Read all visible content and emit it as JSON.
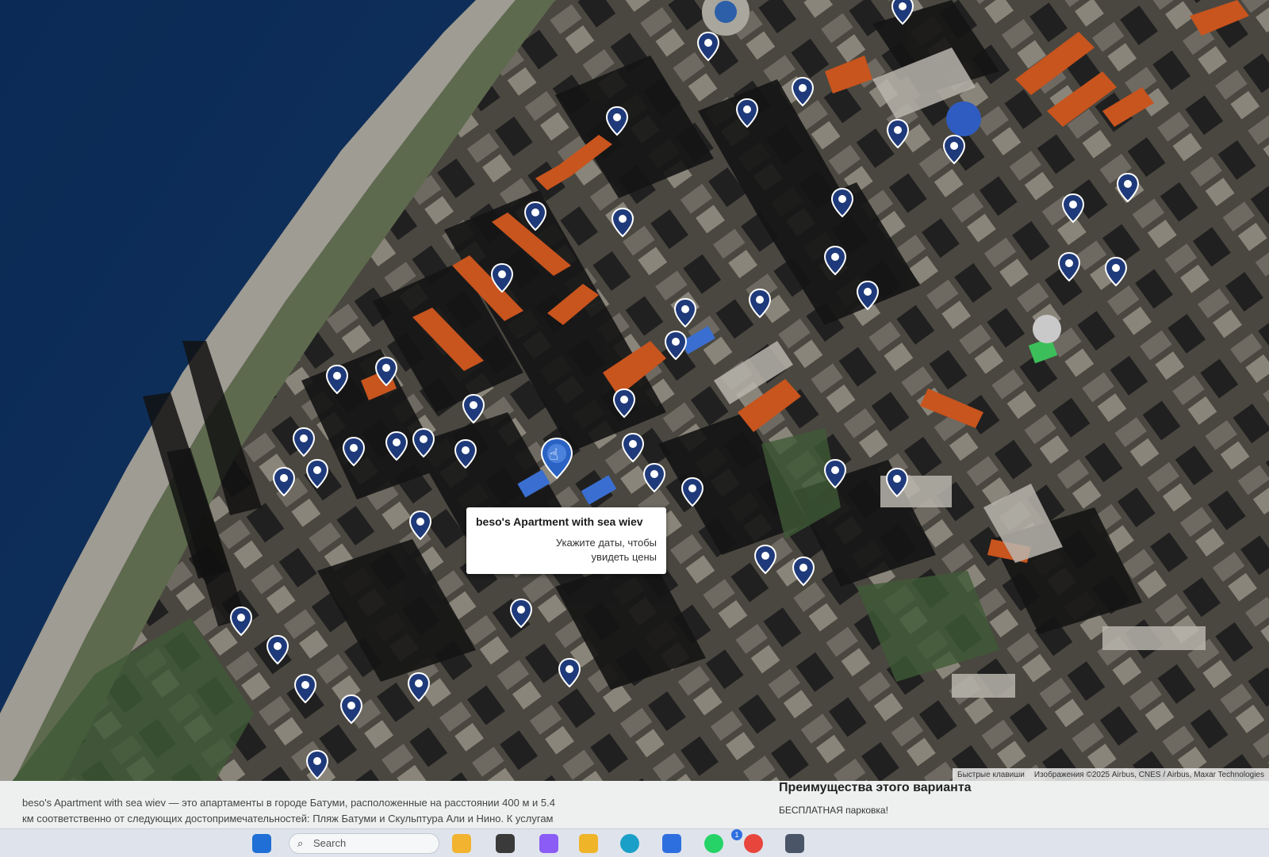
{
  "map": {
    "imagery": "satellite",
    "marker_color": "#1f3a7a",
    "active_marker_color": "#2a63c4",
    "markers_count": 52,
    "markers": [
      {
        "id": "listing-pin"
      },
      {
        "id": "listing-pin"
      },
      {
        "id": "listing-pin"
      },
      {
        "id": "listing-pin"
      },
      {
        "id": "listing-pin"
      },
      {
        "id": "listing-pin"
      },
      {
        "id": "listing-pin"
      },
      {
        "id": "listing-pin"
      },
      {
        "id": "listing-pin"
      },
      {
        "id": "listing-pin"
      },
      {
        "id": "listing-pin"
      },
      {
        "id": "listing-pin"
      },
      {
        "id": "listing-pin"
      },
      {
        "id": "listing-pin"
      },
      {
        "id": "listing-pin"
      },
      {
        "id": "listing-pin"
      },
      {
        "id": "listing-pin"
      },
      {
        "id": "listing-pin"
      },
      {
        "id": "listing-pin"
      },
      {
        "id": "listing-pin"
      },
      {
        "id": "listing-pin"
      },
      {
        "id": "listing-pin"
      },
      {
        "id": "listing-pin"
      },
      {
        "id": "listing-pin"
      },
      {
        "id": "listing-pin"
      },
      {
        "id": "listing-pin"
      },
      {
        "id": "listing-pin"
      },
      {
        "id": "listing-pin"
      },
      {
        "id": "listing-pin"
      },
      {
        "id": "listing-pin"
      },
      {
        "id": "listing-pin"
      },
      {
        "id": "listing-pin"
      },
      {
        "id": "listing-pin"
      },
      {
        "id": "listing-pin"
      },
      {
        "id": "listing-pin"
      },
      {
        "id": "listing-pin"
      },
      {
        "id": "listing-pin"
      },
      {
        "id": "listing-pin"
      },
      {
        "id": "listing-pin"
      },
      {
        "id": "listing-pin"
      },
      {
        "id": "listing-pin"
      },
      {
        "id": "listing-pin"
      },
      {
        "id": "listing-pin"
      },
      {
        "id": "listing-pin"
      },
      {
        "id": "listing-pin"
      },
      {
        "id": "listing-pin"
      },
      {
        "id": "listing-pin"
      },
      {
        "id": "listing-pin"
      },
      {
        "id": "listing-pin"
      },
      {
        "id": "listing-pin"
      },
      {
        "id": "listing-pin"
      },
      {
        "id": "listing-pin"
      }
    ],
    "popup": {
      "title": "beso's Apartment with sea wiev",
      "hint_line1": "Укажите даты, чтобы",
      "hint_line2": "увидеть цены"
    },
    "attribution": {
      "shortcuts": "Быстрые клавиши",
      "imagery": "Изображения ©2025 Airbus, CNES / Airbus, Maxar Technologies"
    }
  },
  "page": {
    "description_line1": "beso's Apartment with sea wiev — это апартаменты в городе Батуми, расположенные на расстоянии 400 м и 5.4",
    "description_line2": "км соответственно от следующих достопримечательностей: Пляж Батуми и Скульптура Али и Нино. К услугам",
    "advantages_title": "Преимущества этого варианта",
    "advantages_first": "БЕСПЛАТНАЯ парковка!"
  },
  "taskbar": {
    "search_placeholder": "Search",
    "notification_count": "1",
    "icons": [
      "start-icon",
      "search-icon",
      "widgets-icon",
      "copilot-icon",
      "file-explorer-icon",
      "edge-icon",
      "store-icon",
      "whatsapp-icon",
      "chrome-icon",
      "calculator-icon"
    ]
  }
}
